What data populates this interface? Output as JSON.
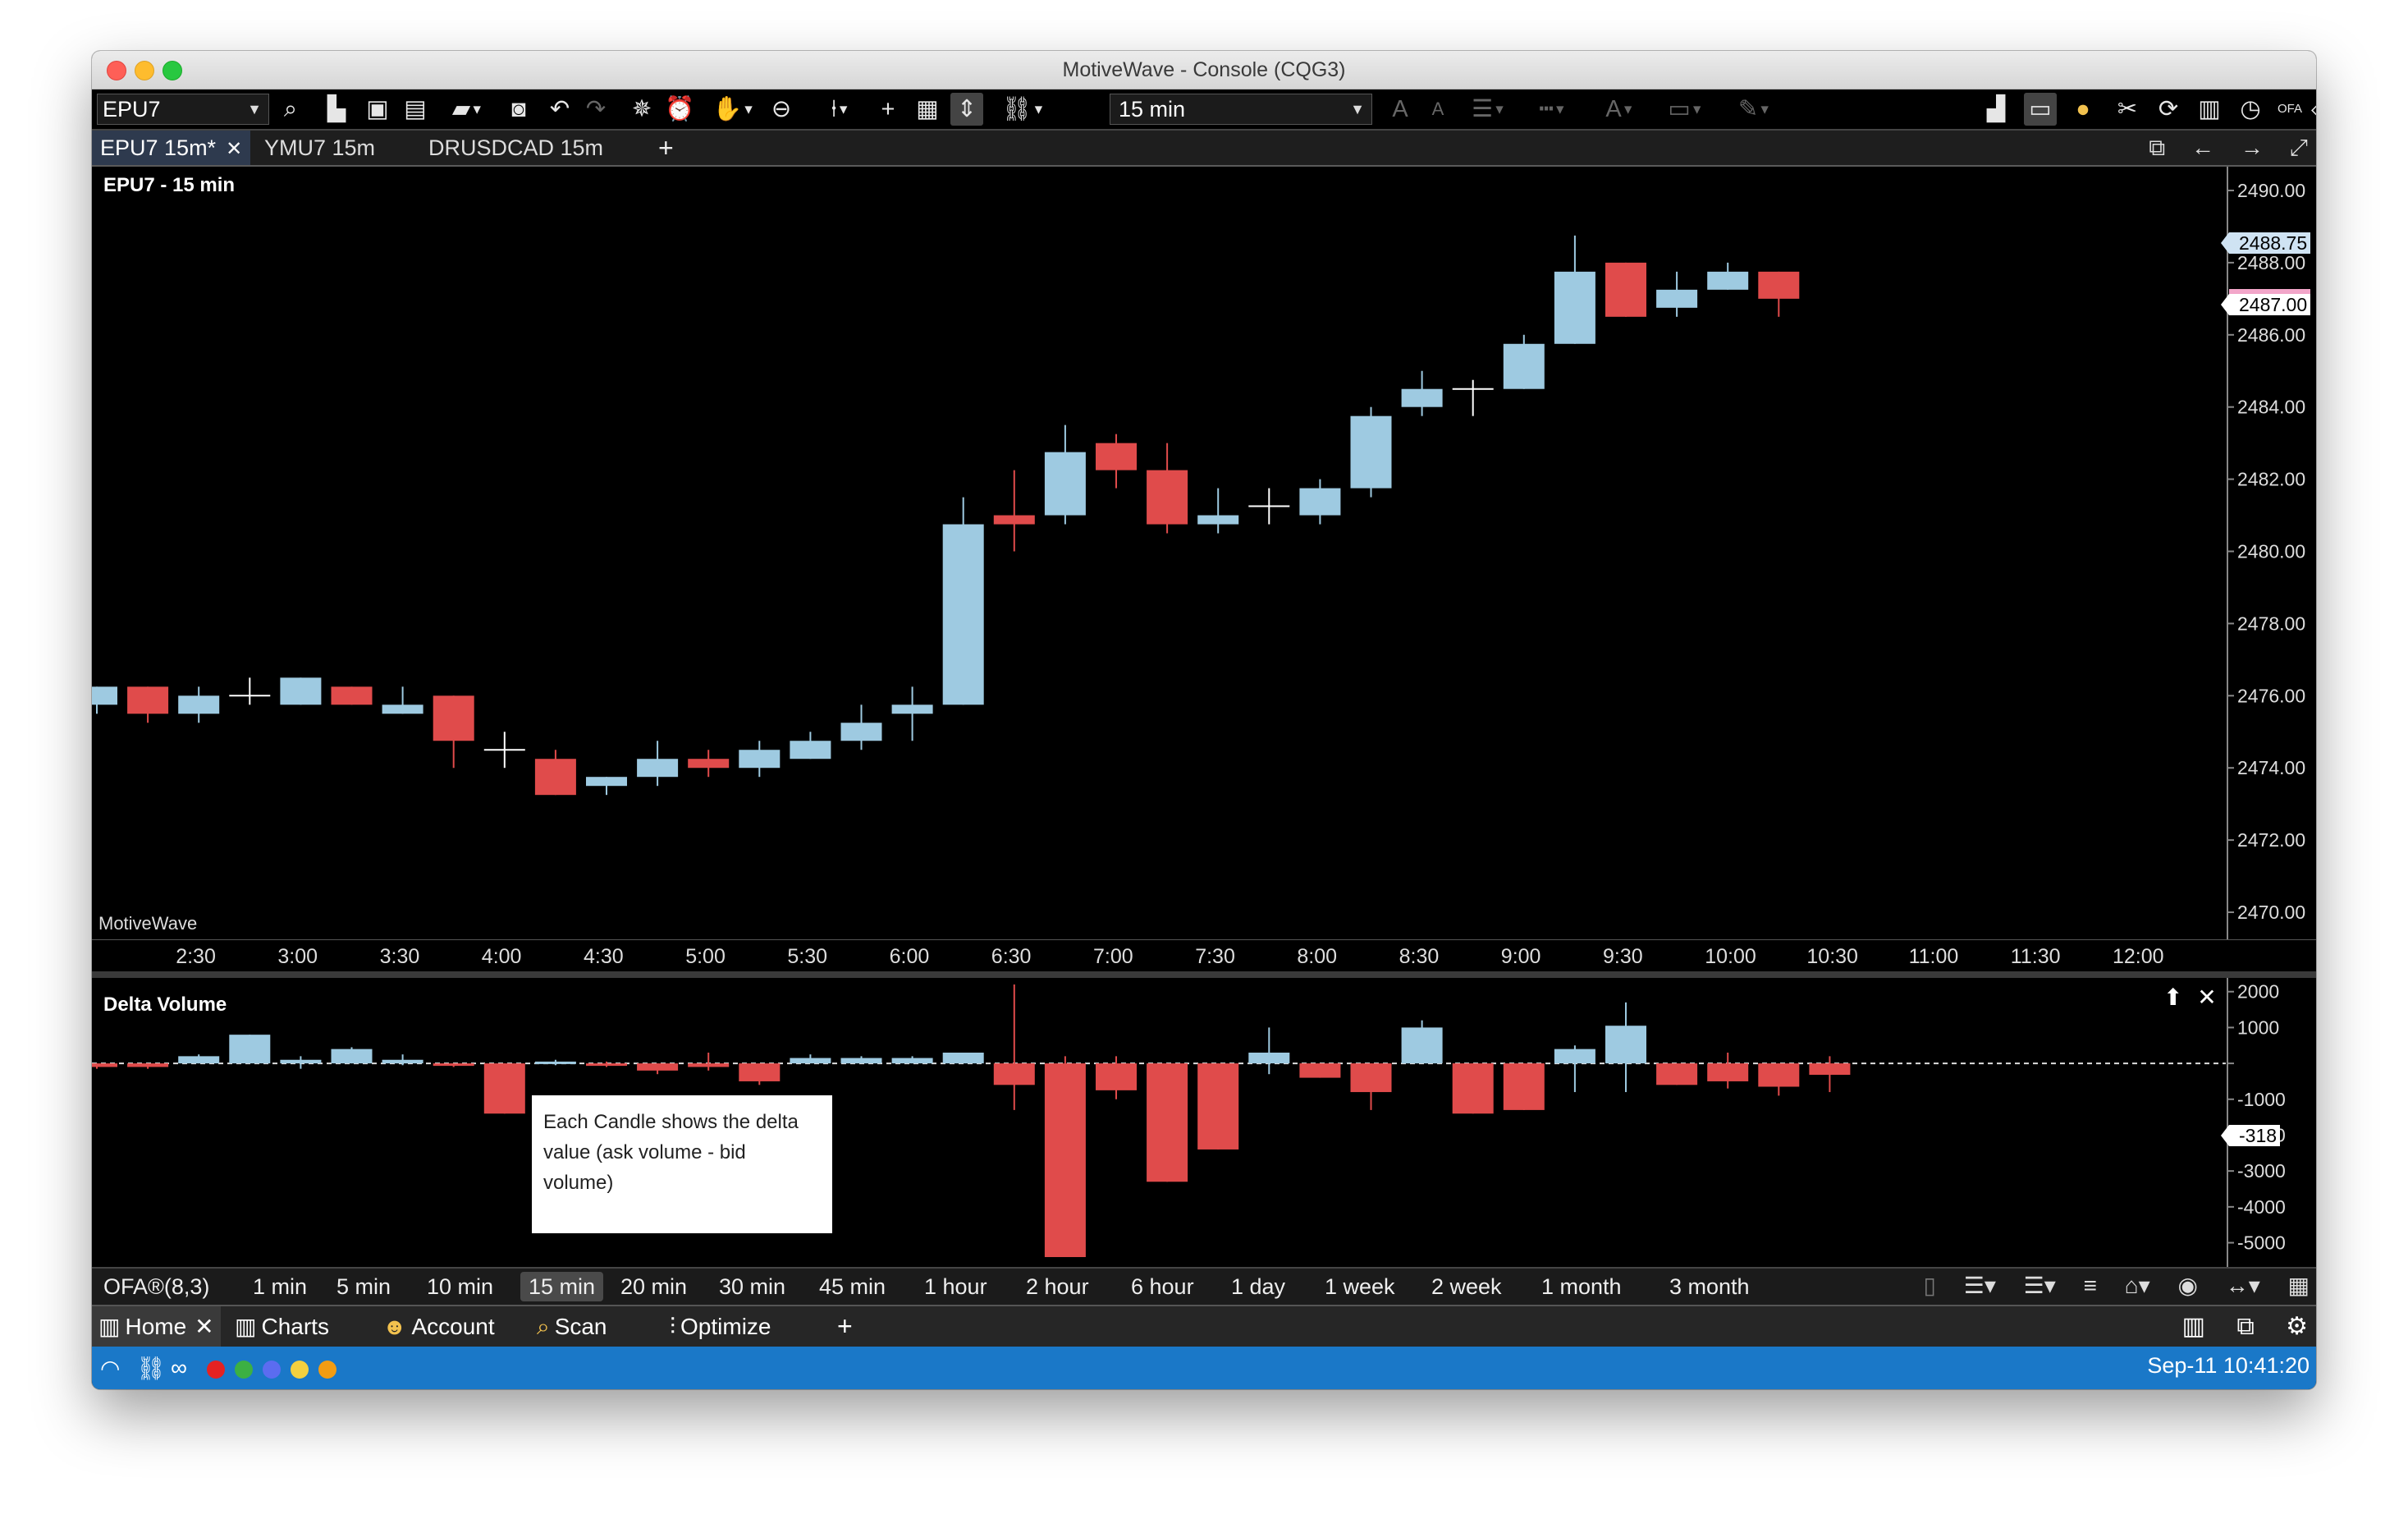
{
  "window": {
    "title": "MotiveWave - Console (CQG3)"
  },
  "toolbar": {
    "symbol": "EPU7",
    "period": "15 min",
    "icons": [
      "search-icon",
      "new-icon",
      "save-icon",
      "save-as-icon",
      "open-icon",
      "camera-icon",
      "undo-icon",
      "redo-icon",
      "magic-icon",
      "alarm-icon",
      "hand-icon",
      "zoom-icon",
      "candle-type-icon",
      "crosshair-icon",
      "toolbox-icon",
      "auto-scale-icon",
      "link-icon",
      "font-size-up-icon",
      "font-size-down-icon",
      "line-width-icon",
      "line-style-icon",
      "text-color-icon",
      "fill-color-icon",
      "line-color-icon",
      "chart-type-icon",
      "display-icon",
      "palette-icon",
      "tools-icon",
      "refresh-icon",
      "table-icon",
      "history-icon",
      "ofa-icon",
      "tag-icon",
      "settings-icon"
    ]
  },
  "tabs": {
    "items": [
      {
        "label": "EPU7 15m*",
        "active": true,
        "closable": true
      },
      {
        "label": "YMU7 15m",
        "active": false,
        "closable": false
      },
      {
        "label": "DRUSDCAD 15m",
        "active": false,
        "closable": false
      }
    ],
    "add": "+"
  },
  "price_pane": {
    "title": "EPU7 - 15 min",
    "watermark": "MotiveWave",
    "last_price_tags": [
      "2488.75",
      "2487.00"
    ]
  },
  "delta_pane": {
    "title": "Delta Volume",
    "last_value_tag": "-318",
    "annotation": "Each Candle shows the delta value (ask volume - bid volume)"
  },
  "chart_data": [
    {
      "type": "candlestick",
      "title": "EPU7 - 15 min",
      "xlabel": "",
      "ylabel": "",
      "ylim": [
        2469.5,
        2490.5
      ],
      "y_ticks": [
        "2490.00",
        "2488.00",
        "2486.00",
        "2484.00",
        "2482.00",
        "2480.00",
        "2478.00",
        "2476.00",
        "2474.00",
        "2472.00",
        "2470.00"
      ],
      "y_tick_values": [
        2490,
        2488,
        2486,
        2484,
        2482,
        2480,
        2478,
        2476,
        2474,
        2472,
        2470
      ],
      "x_ticks": [
        "2:30",
        "3:00",
        "3:30",
        "4:00",
        "4:30",
        "5:00",
        "5:30",
        "6:00",
        "6:30",
        "7:00",
        "7:30",
        "8:00",
        "8:30",
        "9:00",
        "9:30",
        "10:00",
        "10:30",
        "11:00",
        "11:30",
        "12:00"
      ],
      "bar_times": [
        "2:00",
        "2:15",
        "2:30",
        "2:45",
        "3:00",
        "3:15",
        "3:30",
        "3:45",
        "4:00",
        "4:15",
        "4:30",
        "4:45",
        "5:00",
        "5:15",
        "5:30",
        "5:45",
        "6:00",
        "6:15",
        "6:30",
        "6:45",
        "7:00",
        "7:15",
        "7:30",
        "7:45",
        "8:00",
        "8:15",
        "8:30",
        "8:45",
        "9:00",
        "9:15",
        "9:30",
        "9:45",
        "10:00",
        "10:15",
        "10:30"
      ],
      "candles": [
        {
          "o": 2475.75,
          "h": 2476.25,
          "l": 2475.5,
          "c": 2476.25
        },
        {
          "o": 2476.25,
          "h": 2476.25,
          "l": 2475.25,
          "c": 2475.5
        },
        {
          "o": 2475.5,
          "h": 2476.25,
          "l": 2475.25,
          "c": 2476.0
        },
        {
          "o": 2476.0,
          "h": 2476.5,
          "l": 2475.75,
          "c": 2476.0
        },
        {
          "o": 2475.75,
          "h": 2476.5,
          "l": 2475.75,
          "c": 2476.5
        },
        {
          "o": 2476.25,
          "h": 2476.25,
          "l": 2475.75,
          "c": 2475.75
        },
        {
          "o": 2475.5,
          "h": 2476.25,
          "l": 2475.5,
          "c": 2475.75
        },
        {
          "o": 2476.0,
          "h": 2476.0,
          "l": 2474.0,
          "c": 2474.75
        },
        {
          "o": 2474.5,
          "h": 2475.0,
          "l": 2474.0,
          "c": 2474.5
        },
        {
          "o": 2474.25,
          "h": 2474.5,
          "l": 2473.25,
          "c": 2473.25
        },
        {
          "o": 2473.5,
          "h": 2473.75,
          "l": 2473.25,
          "c": 2473.75
        },
        {
          "o": 2473.75,
          "h": 2474.75,
          "l": 2473.5,
          "c": 2474.25
        },
        {
          "o": 2474.25,
          "h": 2474.5,
          "l": 2473.75,
          "c": 2474.0
        },
        {
          "o": 2474.0,
          "h": 2474.75,
          "l": 2473.75,
          "c": 2474.5
        },
        {
          "o": 2474.25,
          "h": 2475.0,
          "l": 2474.25,
          "c": 2474.75
        },
        {
          "o": 2474.75,
          "h": 2475.75,
          "l": 2474.5,
          "c": 2475.25
        },
        {
          "o": 2475.5,
          "h": 2476.25,
          "l": 2474.75,
          "c": 2475.75
        },
        {
          "o": 2475.75,
          "h": 2481.5,
          "l": 2475.75,
          "c": 2480.75
        },
        {
          "o": 2481.0,
          "h": 2482.25,
          "l": 2480.0,
          "c": 2480.75
        },
        {
          "o": 2481.0,
          "h": 2483.5,
          "l": 2480.75,
          "c": 2482.75
        },
        {
          "o": 2483.0,
          "h": 2483.25,
          "l": 2481.75,
          "c": 2482.25
        },
        {
          "o": 2482.25,
          "h": 2483.0,
          "l": 2480.5,
          "c": 2480.75
        },
        {
          "o": 2480.75,
          "h": 2481.75,
          "l": 2480.5,
          "c": 2481.0
        },
        {
          "o": 2481.25,
          "h": 2481.75,
          "l": 2480.75,
          "c": 2481.25
        },
        {
          "o": 2481.0,
          "h": 2482.0,
          "l": 2480.75,
          "c": 2481.75
        },
        {
          "o": 2481.75,
          "h": 2484.0,
          "l": 2481.5,
          "c": 2483.75
        },
        {
          "o": 2484.0,
          "h": 2485.0,
          "l": 2483.75,
          "c": 2484.5
        },
        {
          "o": 2484.5,
          "h": 2484.75,
          "l": 2483.75,
          "c": 2484.5
        },
        {
          "o": 2484.5,
          "h": 2486.0,
          "l": 2484.5,
          "c": 2485.75
        },
        {
          "o": 2485.75,
          "h": 2488.75,
          "l": 2485.75,
          "c": 2487.75
        },
        {
          "o": 2488.0,
          "h": 2488.0,
          "l": 2486.5,
          "c": 2486.5
        },
        {
          "o": 2486.75,
          "h": 2487.75,
          "l": 2486.5,
          "c": 2487.25
        },
        {
          "o": 2487.25,
          "h": 2488.0,
          "l": 2487.25,
          "c": 2487.75
        },
        {
          "o": 2487.75,
          "h": 2487.75,
          "l": 2486.5,
          "c": 2487.0
        }
      ],
      "colors": {
        "up": "#9ecae1",
        "down": "#e04b4b",
        "doji": "#ffffff"
      },
      "grid": false
    },
    {
      "type": "bar",
      "title": "Delta Volume",
      "ylim": [
        -5400,
        2200
      ],
      "y_ticks": [
        "2000",
        "1000",
        "0",
        "-1000",
        "-2000",
        "-3000",
        "-4000",
        "-5000"
      ],
      "y_tick_values": [
        2000,
        1000,
        0,
        -1000,
        -2000,
        -3000,
        -4000,
        -5000
      ],
      "values": [
        -100,
        -100,
        200,
        800,
        100,
        400,
        100,
        -50,
        -1400,
        50,
        -50,
        -200,
        -100,
        -500,
        150,
        150,
        150,
        300,
        -600,
        -5400,
        -750,
        -3300,
        -2400,
        300,
        -400,
        -800,
        1000,
        -1400,
        -1300,
        400,
        1050,
        -600,
        -500,
        -650,
        -318
      ],
      "highs": [
        0,
        0,
        250,
        800,
        200,
        450,
        250,
        0,
        0,
        100,
        50,
        0,
        300,
        0,
        250,
        200,
        200,
        300,
        2200,
        200,
        200,
        0,
        0,
        1000,
        0,
        0,
        1200,
        0,
        0,
        500,
        1700,
        0,
        300,
        0,
        200
      ],
      "lows": [
        -150,
        -150,
        0,
        0,
        -150,
        0,
        -50,
        -100,
        -1400,
        -50,
        -100,
        -300,
        -200,
        -600,
        0,
        0,
        0,
        0,
        -1300,
        -5400,
        -1000,
        -3300,
        -2400,
        -300,
        -400,
        -1300,
        0,
        -1400,
        -1300,
        -800,
        -800,
        -600,
        -700,
        -900,
        -800
      ],
      "zero_line": "dashed",
      "colors": {
        "up": "#9ecae1",
        "down": "#e04b4b"
      }
    }
  ],
  "bar_periods": {
    "indicator": "OFA®(8,3)",
    "items": [
      "1 min",
      "5 min",
      "10 min",
      "15 min",
      "20 min",
      "30 min",
      "45 min",
      "1 hour",
      "2 hour",
      "6 hour",
      "1 day",
      "1 week",
      "2 week",
      "1 month",
      "3 month"
    ],
    "active": "15 min",
    "right_icons": [
      "trash-icon",
      "align-left-icon",
      "align-right-icon",
      "list-icon",
      "chart-settings-icon",
      "eye-icon",
      "range-icon",
      "calendar-icon"
    ]
  },
  "nav": {
    "items": [
      {
        "label": "Home",
        "icon": "bar-chart-icon",
        "active": true
      },
      {
        "label": "Charts",
        "icon": "bar-chart-icon",
        "active": false
      },
      {
        "label": "Account",
        "icon": "account-icon",
        "active": false
      },
      {
        "label": "Scan",
        "icon": "scan-icon",
        "active": false
      },
      {
        "label": "Optimize",
        "icon": "sliders-icon",
        "active": false
      }
    ],
    "add": "+",
    "right_icons": [
      "layout-icon",
      "documents-icon",
      "settings-icon"
    ]
  },
  "status": {
    "time": "Sep-11 10:41:20",
    "dot_colors": [
      "#e52222",
      "#3cb043",
      "#5b6cf0",
      "#f4d03f",
      "#f39c12"
    ]
  }
}
